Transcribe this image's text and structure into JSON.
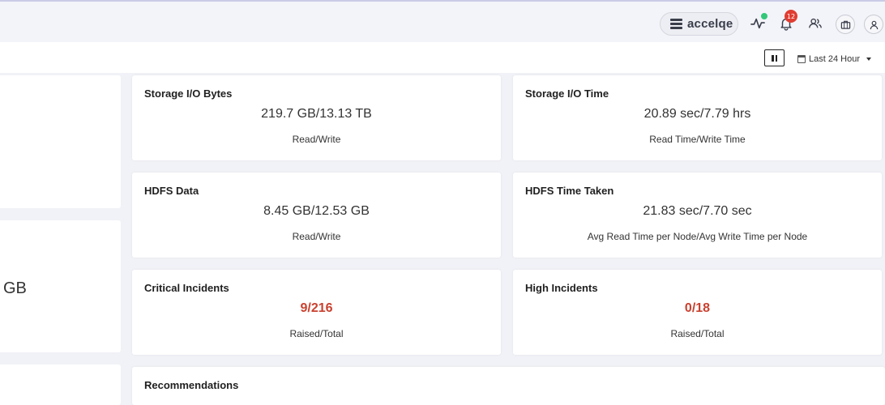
{
  "header": {
    "cluster_name": "accelqe",
    "notifications_count": "12",
    "colors": {
      "activity_dot": "#33c77a",
      "badge": "#e03c31"
    }
  },
  "filter": {
    "time_range": "Last 24 Hour"
  },
  "left_panel": {
    "partial_value": "GB"
  },
  "cards": {
    "storage_io_bytes": {
      "title": "Storage I/O Bytes",
      "value": "219.7 GB/13.13 TB",
      "sub": "Read/Write"
    },
    "storage_io_time": {
      "title": "Storage I/O Time",
      "value": "20.89 sec/7.79 hrs",
      "sub": "Read Time/Write Time"
    },
    "hdfs_data": {
      "title": "HDFS Data",
      "value": "8.45 GB/12.53 GB",
      "sub": "Read/Write"
    },
    "hdfs_time_taken": {
      "title": "HDFS Time Taken",
      "value": "21.83 sec/7.70 sec",
      "sub": "Avg Read Time per Node/Avg Write Time per Node"
    },
    "critical_incidents": {
      "title": "Critical Incidents",
      "value": "9/216",
      "sub": "Raised/Total"
    },
    "high_incidents": {
      "title": "High Incidents",
      "value": "0/18",
      "sub": "Raised/Total"
    },
    "recommendations": {
      "title": "Recommendations"
    }
  },
  "accent_colors": {
    "incident_value": "#c9412f"
  }
}
